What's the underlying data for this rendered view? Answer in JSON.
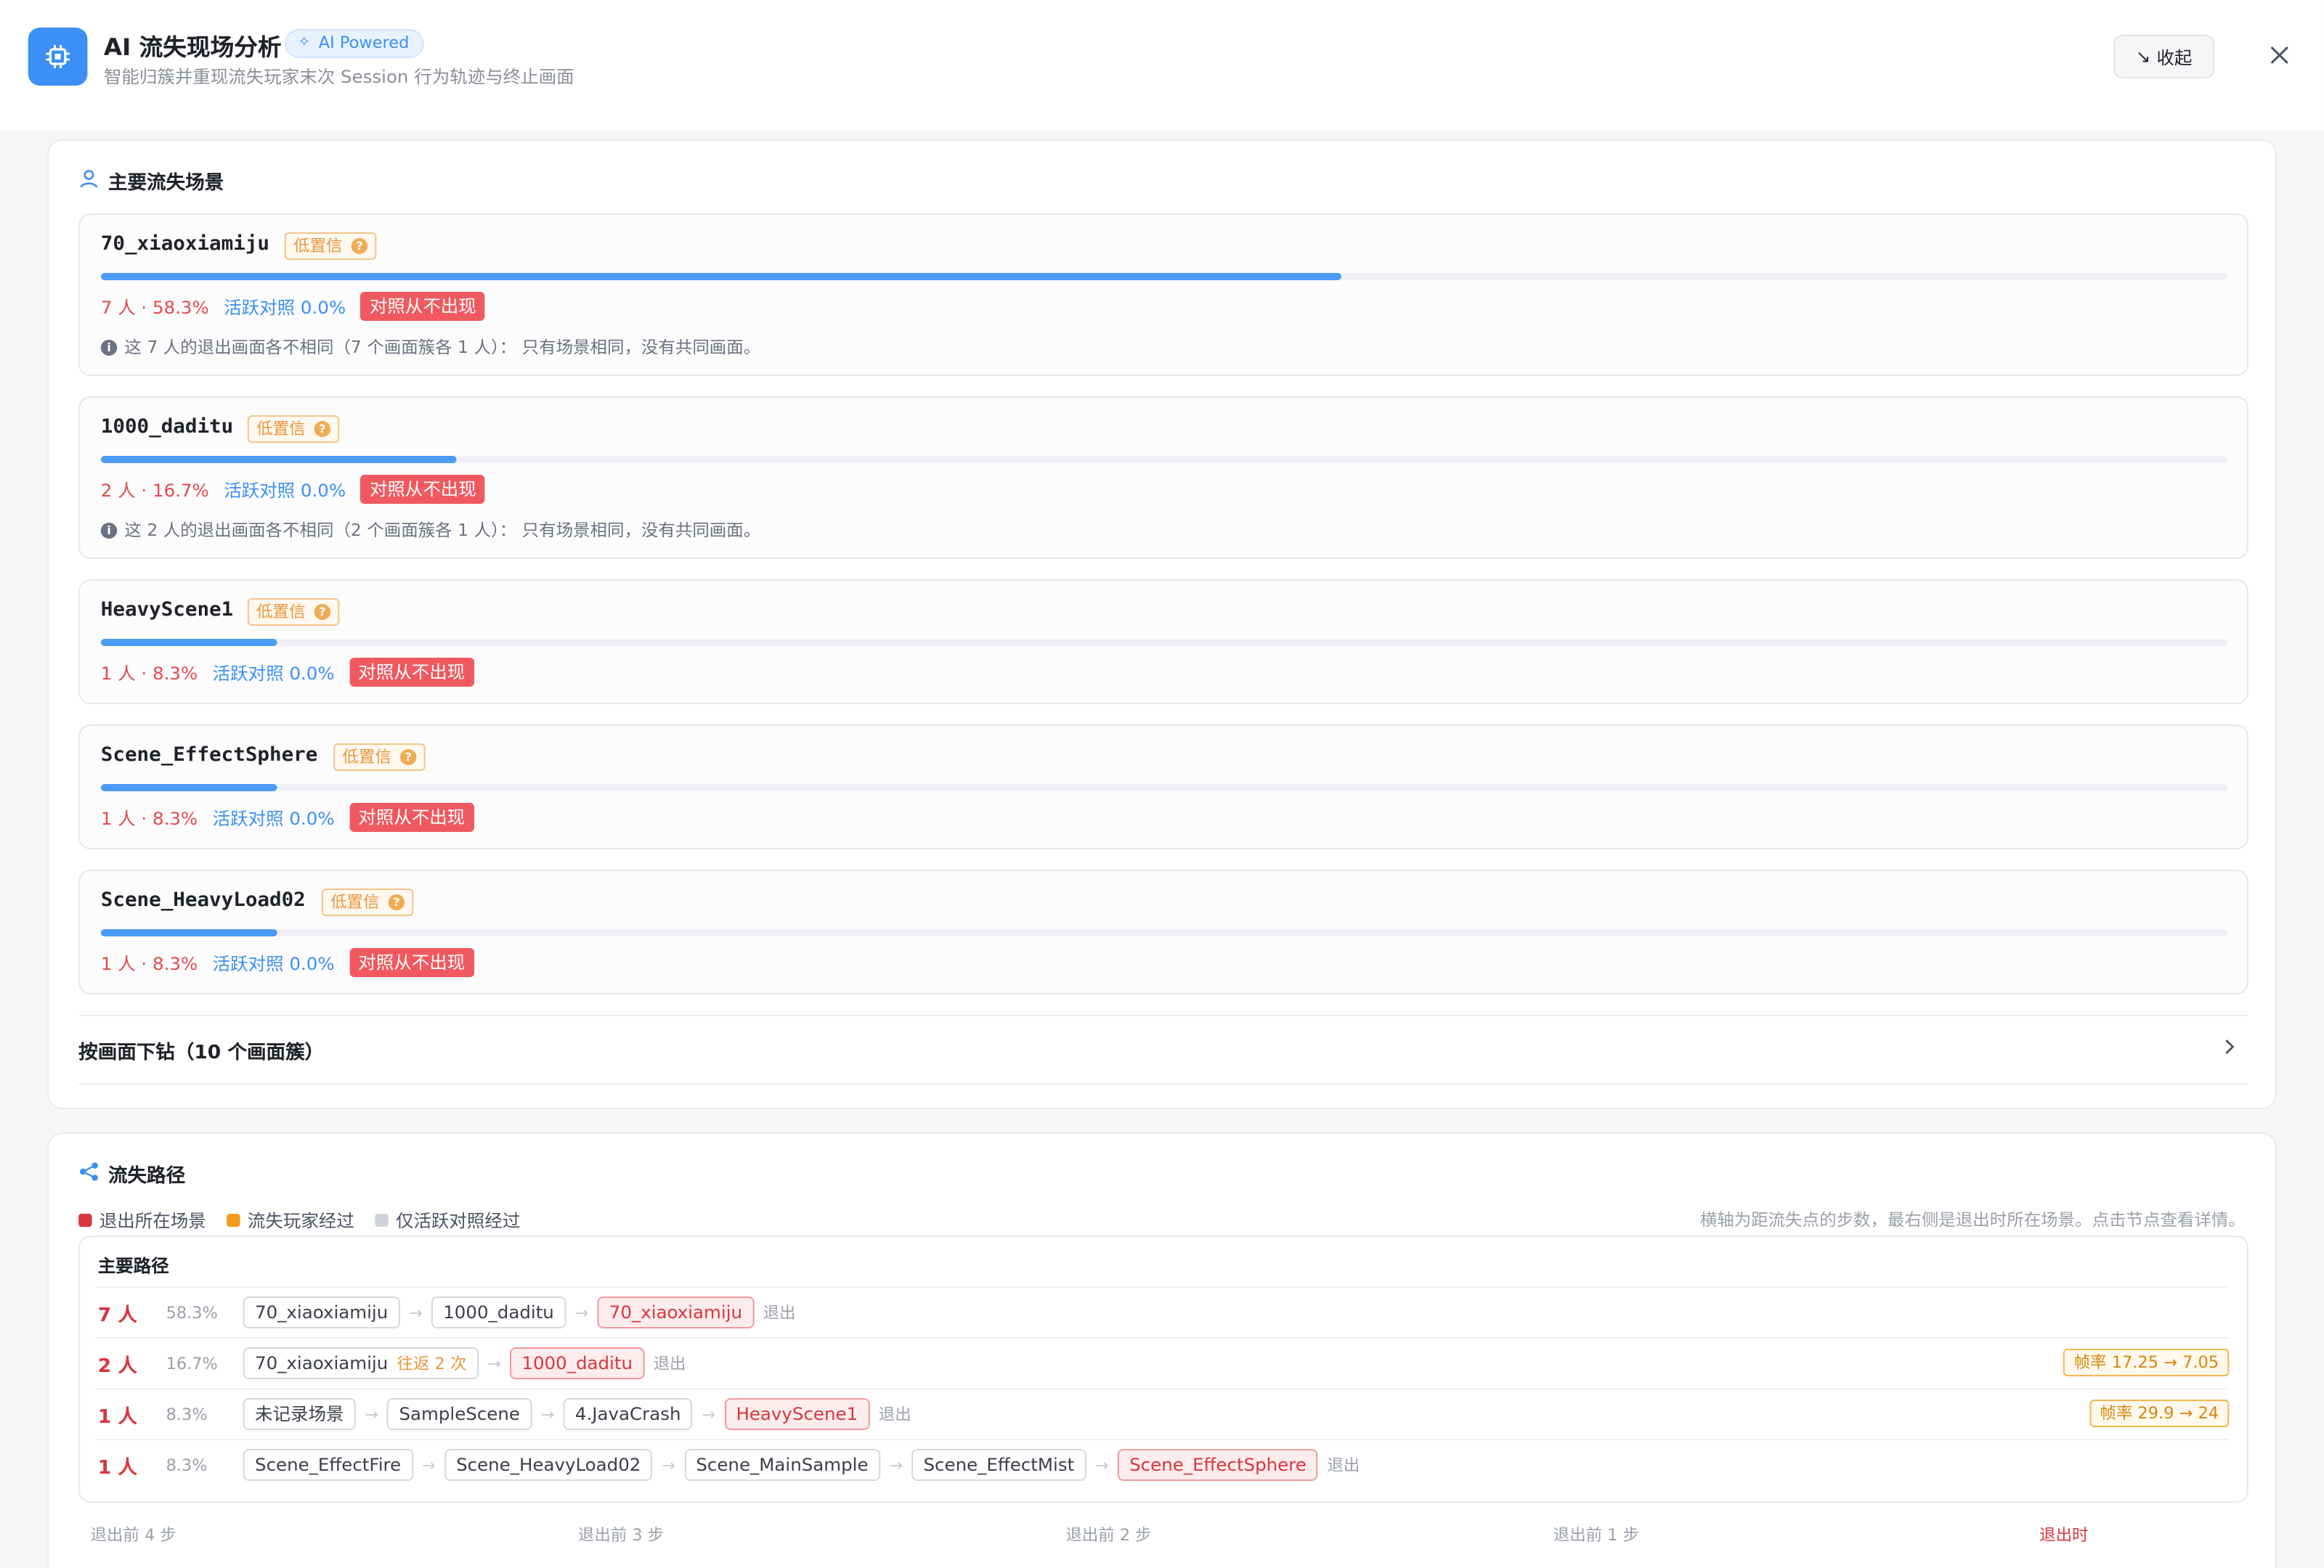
{
  "header": {
    "title": "AI 流失现场分析",
    "badge": "AI Powered",
    "subtitle": "智能归簇并重现流失玩家末次 Session 行为轨迹与终止画面",
    "collapse_label": "收起"
  },
  "scenes_section": {
    "title": "主要流失场景",
    "confidence_label": "低置信",
    "never_label": "对照从不出现",
    "items": [
      {
        "name": "70_xiaoxiamiju",
        "count": "7 人 · 58.3%",
        "active": "活跃对照 0.0%",
        "share": 0.583,
        "note": "这 7 人的退出画面各不相同（7 个画面簇各 1 人）：  只有场景相同，没有共同画面。"
      },
      {
        "name": "1000_daditu",
        "count": "2 人 · 16.7%",
        "active": "活跃对照 0.0%",
        "share": 0.167,
        "note": "这 2 人的退出画面各不相同（2 个画面簇各 1 人）：  只有场景相同，没有共同画面。"
      },
      {
        "name": "HeavyScene1",
        "count": "1 人 · 8.3%",
        "active": "活跃对照 0.0%",
        "share": 0.083
      },
      {
        "name": "Scene_EffectSphere",
        "count": "1 人 · 8.3%",
        "active": "活跃对照 0.0%",
        "share": 0.083
      },
      {
        "name": "Scene_HeavyLoad02",
        "count": "1 人 · 8.3%",
        "active": "活跃对照 0.0%",
        "share": 0.083
      }
    ],
    "drill_label": "按画面下钻（10 个画面簇）"
  },
  "path_section": {
    "title": "流失路径",
    "legend": [
      {
        "label": "退出所在场景",
        "color": "#d9363e"
      },
      {
        "label": "流失玩家经过",
        "color": "#f29b1d"
      },
      {
        "label": "仅活跃对照经过",
        "color": "#cfd3da"
      }
    ],
    "hint": "横轴为距流失点的步数，最右侧是退出时所在场景。点击节点查看详情。",
    "box_title": "主要路径",
    "exit_label": "退出",
    "rows": [
      {
        "count": "7 人",
        "pct": "58.3%",
        "nodes": [
          {
            "name": "70_xiaoxiamiju"
          },
          {
            "name": "1000_daditu"
          },
          {
            "name": "70_xiaoxiamiju",
            "end": true
          }
        ]
      },
      {
        "count": "2 人",
        "pct": "16.7%",
        "nodes": [
          {
            "name": "70_xiaoxiamiju",
            "loop": "往返 2 次"
          },
          {
            "name": "1000_daditu",
            "end": true
          }
        ],
        "fps": "帧率 17.25 → 7.05"
      },
      {
        "count": "1 人",
        "pct": "8.3%",
        "nodes": [
          {
            "name": "未记录场景"
          },
          {
            "name": "SampleScene"
          },
          {
            "name": "4.JavaCrash"
          },
          {
            "name": "HeavyScene1",
            "end": true
          }
        ],
        "fps": "帧率 29.9 → 24"
      },
      {
        "count": "1 人",
        "pct": "8.3%",
        "nodes": [
          {
            "name": "Scene_EffectFire"
          },
          {
            "name": "Scene_HeavyLoad02"
          },
          {
            "name": "Scene_MainSample"
          },
          {
            "name": "Scene_EffectMist"
          },
          {
            "name": "Scene_EffectSphere",
            "end": true
          }
        ]
      }
    ],
    "steps": [
      "退出前 4 步",
      "退出前 3 步",
      "退出前 2 步",
      "退出前 1 步",
      "退出时"
    ]
  },
  "colors": {
    "accent": "#3b8ff5",
    "danger": "#d9363e",
    "warning": "#e8963c"
  },
  "icons": {
    "app": "chip-icon",
    "badge": "sparkle-icon",
    "collapse": "arrow-down-right-icon",
    "close": "close-icon",
    "scenes": "user-icon",
    "path": "share-icon",
    "drill": "chevron-right-icon",
    "info": "info-icon",
    "question": "question-icon"
  }
}
